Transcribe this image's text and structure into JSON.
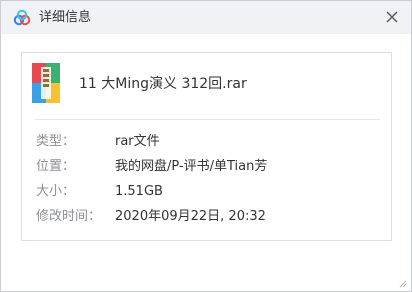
{
  "dialog": {
    "title": "详细信息",
    "close_symbol": "×",
    "logo_icon": "baidu-netdisk-cloud-icon"
  },
  "file": {
    "icon": "rar-archive-icon",
    "name": "11 大Ming演义 312回.rar"
  },
  "details": [
    {
      "label": "类型：",
      "value": "rar文件"
    },
    {
      "label": "位置：",
      "value": "我的网盘/P-评书/单Tian芳"
    },
    {
      "label": "大小：",
      "value": "1.51GB"
    },
    {
      "label": "修改时间：",
      "value": "2020年09月22日, 20:32"
    }
  ],
  "colors": {
    "titlebar_bg": "#f0f2f5",
    "label_text": "#8c9097",
    "value_text": "#333333",
    "border": "#dcdfe6"
  }
}
